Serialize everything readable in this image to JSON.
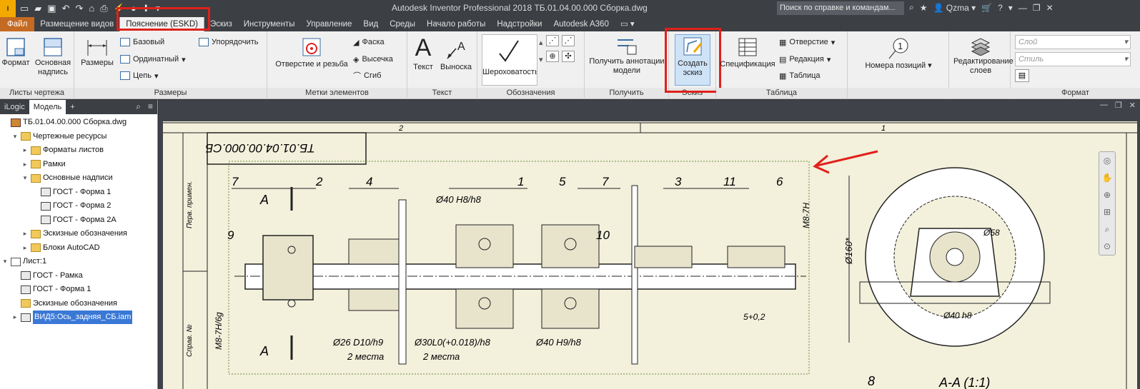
{
  "titlebar": {
    "app_title": "Autodesk Inventor Professional 2018    ТБ.01.04.00.000 Сборка.dwg",
    "search_placeholder": "Поиск по справке и командам...",
    "user": "Qzma",
    "logo": "I PRO"
  },
  "ribbon_tabs": [
    {
      "label": "Файл"
    },
    {
      "label": "Размещение видов"
    },
    {
      "label": "Пояснение (ESKD)"
    },
    {
      "label": "Эскиз"
    },
    {
      "label": "Инструменты"
    },
    {
      "label": "Управление"
    },
    {
      "label": "Вид"
    },
    {
      "label": "Среды"
    },
    {
      "label": "Начало работы"
    },
    {
      "label": "Надстройки"
    },
    {
      "label": "Autodesk A360"
    }
  ],
  "ribbon": {
    "format_btn": "Формат",
    "title_block_btn": "Основная надпись",
    "sheets_group": "Листы чертежа",
    "sizes_btn": "Размеры",
    "basic_btn": "Базовый",
    "ordinate_btn": "Ординатный",
    "chain_btn": "Цепь",
    "arrange_btn": "Упорядочить",
    "dims_group": "Размеры",
    "hole_thread_btn": "Отверстие и резьба",
    "chamfer_btn": "Фаска",
    "punch_btn": "Высечка",
    "bend_btn": "Сгиб",
    "feature_notes_group": "Метки элементов",
    "text_btn": "Текст",
    "leader_btn": "Выноска",
    "text_group": "Текст",
    "roughness_btn": "Шероховатость",
    "symbols_group": "Обозначения",
    "get_annotations_btn": "Получить аннотации модели",
    "get_group": "Получить",
    "create_sketch_btn": "Создать эскиз",
    "sketch_group": "Эскиз",
    "spec_btn": "Спецификация",
    "hole_table_btn": "Отверстие",
    "revision_btn": "Редакция",
    "table_btn": "Таблица",
    "table_group": "Таблица",
    "balloons_btn": "Номера позиций",
    "edit_layers_btn": "Редактирование слоев",
    "layer_placeholder": "Слой",
    "style_placeholder": "Стиль",
    "format_group": "Формат"
  },
  "browser": {
    "tabs": [
      "iLogic",
      "Модель"
    ],
    "tree": [
      {
        "label": "ТБ.01.04.00.000 Сборка.dwg",
        "level": 0,
        "icon": "dwg",
        "exp": ""
      },
      {
        "label": "Чертежные ресурсы",
        "level": 1,
        "icon": "folder",
        "exp": "▾"
      },
      {
        "label": "Форматы листов",
        "level": 2,
        "icon": "folder",
        "exp": "▸"
      },
      {
        "label": "Рамки",
        "level": 2,
        "icon": "folder",
        "exp": "▸"
      },
      {
        "label": "Основные надписи",
        "level": 2,
        "icon": "folder",
        "exp": "▾"
      },
      {
        "label": "ГОСТ - Форма 1",
        "level": 3,
        "icon": "form",
        "exp": ""
      },
      {
        "label": "ГОСТ - Форма 2",
        "level": 3,
        "icon": "form",
        "exp": ""
      },
      {
        "label": "ГОСТ - Форма 2А",
        "level": 3,
        "icon": "form",
        "exp": ""
      },
      {
        "label": "Эскизные обозначения",
        "level": 2,
        "icon": "folder",
        "exp": "▸"
      },
      {
        "label": "Блоки AutoCAD",
        "level": 2,
        "icon": "folder",
        "exp": "▸"
      },
      {
        "label": "Лист:1",
        "level": 0,
        "icon": "sheet",
        "exp": "▾"
      },
      {
        "label": "ГОСТ - Рамка",
        "level": 1,
        "icon": "form",
        "exp": ""
      },
      {
        "label": "ГОСТ - Форма 1",
        "level": 1,
        "icon": "form",
        "exp": ""
      },
      {
        "label": "Эскизные обозначения",
        "level": 1,
        "icon": "folder",
        "exp": ""
      },
      {
        "label": "ВИД5:Ось_задняя_СБ.iam",
        "level": 1,
        "icon": "form",
        "exp": "▸",
        "selected": true
      }
    ]
  },
  "drawing": {
    "zone_2": "2",
    "zone_1": "1",
    "stamp_text": "ТБ.01.04.00.000.СБ",
    "perv_primen": "Перв. примен.",
    "sprav_no": "Справ. №",
    "labels": [
      "7",
      "2",
      "4",
      "1",
      "5",
      "7",
      "3",
      "11",
      "6",
      "9",
      "10"
    ],
    "section_a_top": "A",
    "section_a_bottom": "A",
    "dim_40h8": "Ø40 H8/h8",
    "dim_26": "Ø26 D10/h9",
    "two_places_1": "2 места",
    "dim_30": "Ø30L0(+0.018)/h8",
    "two_places_2": "2 места",
    "dim_40h9": "Ø40 H9/h8",
    "thread_m8_left": "M8-7H/6g",
    "thread_m8_right": "M8-7H",
    "dim_5": "5+0,2",
    "dim_160": "Ø160*",
    "dim_58": "Ø58",
    "dim_40h8_section": "Ø40 h8",
    "section_title": "A-A (1:1)",
    "item_8": "8"
  },
  "colors": {
    "accent_red": "#e0201a",
    "file_tab": "#c46a22",
    "sheet_bg": "#f3f0dc",
    "selection": "#3a78d6"
  }
}
